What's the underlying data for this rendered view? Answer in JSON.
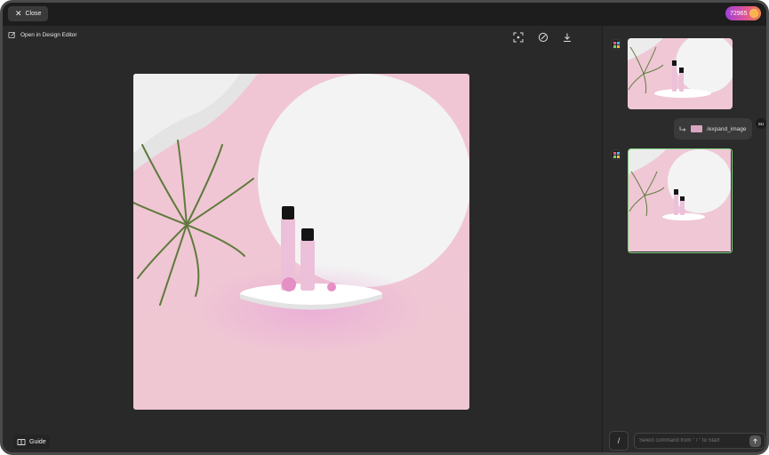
{
  "topbar": {
    "close_label": "Close",
    "credits": "72965"
  },
  "main": {
    "open_editor_label": "Open in Design Editor",
    "tools": [
      "expand-icon",
      "edit-circle-icon",
      "download-icon"
    ],
    "guide_label": "Guide"
  },
  "sidebar": {
    "command_label": "/expand_image",
    "user_initials": "SU",
    "input_placeholder": "Select command from \" / \" to Start",
    "slash_label": "/"
  },
  "colors": {
    "background": "#292929",
    "topbar": "#1d1d1d",
    "accent_green": "#7fd37a",
    "pink_wall": "#f1c7d6",
    "credits_gradient_start": "#a03fd8",
    "credits_gradient_end": "#f08a3e"
  }
}
